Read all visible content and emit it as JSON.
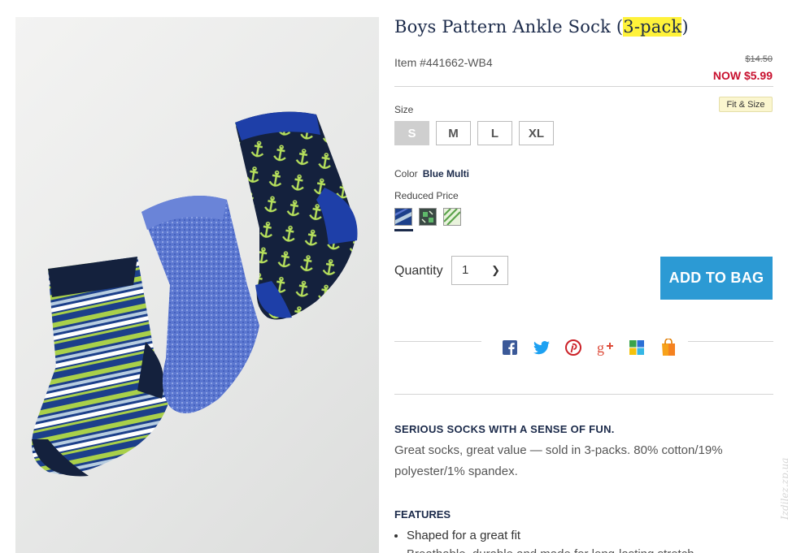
{
  "product": {
    "title_main": "Boys Pattern Ankle Sock (",
    "title_highlight": "3-pack",
    "title_end": ")",
    "item_number": "Item #441662-WB4",
    "was_price": "$14.50",
    "now_price": "NOW $5.99"
  },
  "size": {
    "label": "Size",
    "fit_link": "Fit & Size",
    "options": [
      "S",
      "M",
      "L",
      "XL"
    ],
    "selected": "S"
  },
  "color": {
    "label": "Color",
    "value": "Blue Multi",
    "reduced_label": "Reduced Price",
    "swatch_icons": [
      "blue-stripe-swatch",
      "green-pattern-swatch",
      "green-stripe-swatch"
    ]
  },
  "quantity": {
    "label": "Quantity",
    "value": "1"
  },
  "add_to_bag": "ADD TO BAG",
  "social_icons": [
    "facebook-icon",
    "twitter-icon",
    "pinterest-icon",
    "google-plus-icon",
    "windows-icon",
    "shopping-bag-icon"
  ],
  "description": {
    "heading": "SERIOUS SOCKS WITH A SENSE OF FUN.",
    "body": "Great socks, great value — sold in 3-packs. 80% cotton/19% polyester/1% spandex."
  },
  "features": {
    "heading": "FEATURES",
    "items": [
      "Shaped for a great fit"
    ],
    "partial_next": "Breathable, durable and made for long-lasting stretch"
  },
  "watermark": "Izdilez.zp.ua",
  "colors": {
    "navy": "#1b2a4a",
    "sale_red": "#c8102e",
    "button_blue": "#2c9ad4",
    "highlight": "#fff23a"
  }
}
